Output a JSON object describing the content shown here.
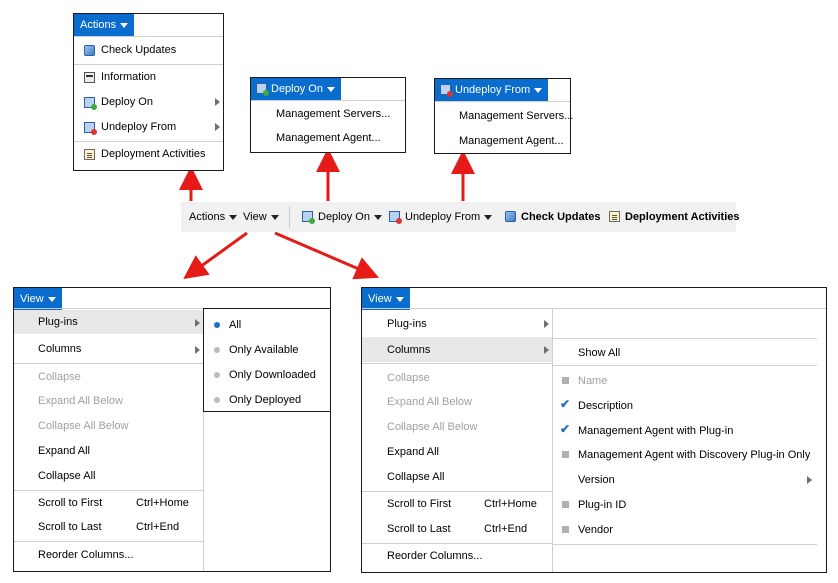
{
  "actions_menu": {
    "header": "Actions",
    "items": {
      "check_updates": "Check Updates",
      "information": "Information",
      "deploy_on": "Deploy On",
      "undeploy_from": "Undeploy From",
      "deployment_activities": "Deployment Activities"
    }
  },
  "deploy_on_menu": {
    "header": "Deploy On",
    "items": [
      "Management Servers...",
      "Management Agent..."
    ]
  },
  "undeploy_from_menu": {
    "header": "Undeploy From",
    "items": [
      "Management Servers...",
      "Management Agent..."
    ]
  },
  "toolbar": {
    "actions": "Actions",
    "view": "View",
    "deploy_on": "Deploy On",
    "undeploy_from": "Undeploy From",
    "check_updates": "Check Updates",
    "deployment_activities": "Deployment Activities"
  },
  "view_menu": {
    "header": "View",
    "plugins": "Plug-ins",
    "columns": "Columns",
    "collapse": "Collapse",
    "expand_all_below": "Expand All Below",
    "collapse_all_below": "Collapse All Below",
    "expand_all": "Expand All",
    "collapse_all": "Collapse All",
    "scroll_to_first": "Scroll to First",
    "scroll_to_first_shortcut": "Ctrl+Home",
    "scroll_to_last": "Scroll to Last",
    "scroll_to_last_shortcut": "Ctrl+End",
    "reorder_columns": "Reorder Columns..."
  },
  "plugins_submenu": {
    "items": [
      "All",
      "Only Available",
      "Only Downloaded",
      "Only Deployed"
    ],
    "selected": "All"
  },
  "columns_submenu": {
    "show_all": "Show All",
    "name": "Name",
    "description": "Description",
    "mgmt_agent_plugin": "Management Agent with Plug-in",
    "mgmt_agent_discovery": "Management Agent with Discovery Plug-in Only",
    "version": "Version",
    "plugin_id": "Plug-in ID",
    "vendor": "Vendor"
  },
  "colors": {
    "header_blue": "#0a6ccc",
    "arrow_red": "#e41b17",
    "check_blue": "#1f6fc9",
    "disabled_gray": "#a0a0a0"
  }
}
